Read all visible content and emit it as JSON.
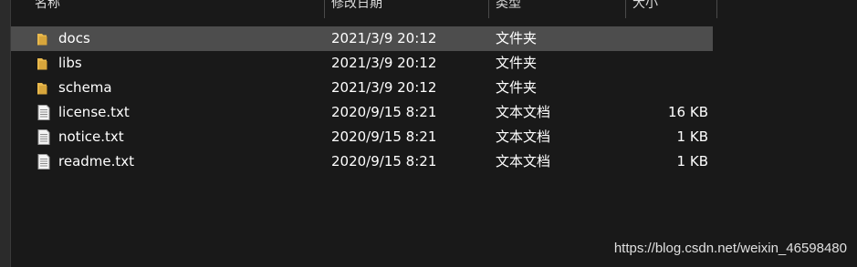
{
  "columns": {
    "name": "名称",
    "date": "修改日期",
    "type": "类型",
    "size": "大小"
  },
  "files": [
    {
      "name": "docs",
      "date": "2021/3/9 20:12",
      "type": "文件夹",
      "size": "",
      "icon": "folder-icon",
      "selected": true
    },
    {
      "name": "libs",
      "date": "2021/3/9 20:12",
      "type": "文件夹",
      "size": "",
      "icon": "folder-icon",
      "selected": false
    },
    {
      "name": "schema",
      "date": "2021/3/9 20:12",
      "type": "文件夹",
      "size": "",
      "icon": "folder-icon",
      "selected": false
    },
    {
      "name": "license.txt",
      "date": "2020/9/15 8:21",
      "type": "文本文档",
      "size": "16 KB",
      "icon": "text-file-icon",
      "selected": false
    },
    {
      "name": "notice.txt",
      "date": "2020/9/15 8:21",
      "type": "文本文档",
      "size": "1 KB",
      "icon": "text-file-icon",
      "selected": false
    },
    {
      "name": "readme.txt",
      "date": "2020/9/15 8:21",
      "type": "文本文档",
      "size": "1 KB",
      "icon": "text-file-icon",
      "selected": false
    }
  ],
  "watermark": "https://blog.csdn.net/weixin_46598480",
  "colors": {
    "background": "#191919",
    "selected_row": "#4d4d4d",
    "folder": "#e9b94d",
    "text": "#ffffff"
  }
}
